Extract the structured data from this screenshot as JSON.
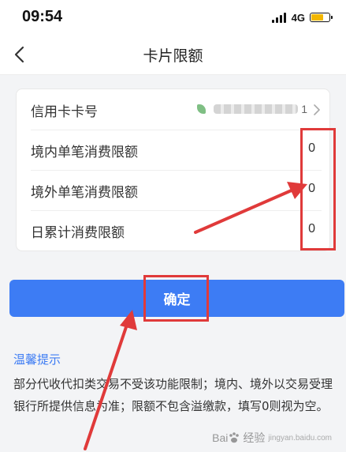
{
  "status_bar": {
    "time": "09:54",
    "network": "4G"
  },
  "header": {
    "title": "卡片限额",
    "back_icon": "chevron-left-icon"
  },
  "form": {
    "rows": [
      {
        "label": "信用卡卡号",
        "value": "",
        "masked_tail": "1",
        "icon": "chevron-right-icon"
      },
      {
        "label": "境内单笔消费限额",
        "value": "0"
      },
      {
        "label": "境外单笔消费限额",
        "value": "0"
      },
      {
        "label": "日累计消费限额",
        "value": "0"
      }
    ]
  },
  "confirm_button": {
    "label": "确定"
  },
  "tips": {
    "title": "温馨提示",
    "text": "部分代收代扣类交易不受该功能限制；境内、境外以交易受理银行所提供信息为准；限额不包含溢缴款，填写0则视为空。"
  },
  "annotations": {
    "color": "#e03a3a"
  },
  "colors": {
    "primary": "#3d7cf4",
    "highlight": "#e03a3a"
  },
  "watermark": {
    "text": "Bai",
    "text_suffix": "经验",
    "sub": "jingyan.baidu.com"
  }
}
